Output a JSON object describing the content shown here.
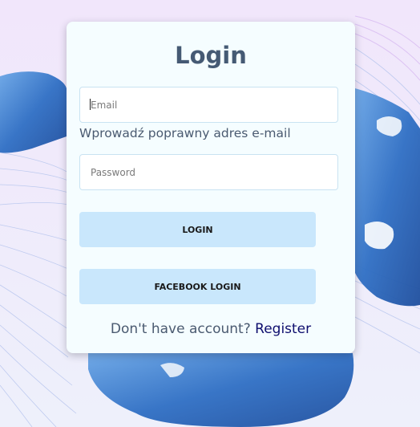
{
  "login_card": {
    "title": "Login",
    "email": {
      "placeholder": "Email",
      "value": ""
    },
    "email_hint": "Wprowadź poprawny adres e-mail",
    "password": {
      "placeholder": "Password",
      "value": ""
    },
    "login_button_label": "LOGIN",
    "facebook_button_label": "FACEBOOK LOGIN",
    "register_prompt": "Don't have account?",
    "register_link": "Register"
  },
  "colors": {
    "card_background": "#f5fdff",
    "title": "#455a74",
    "button_background": "#c9e7fc",
    "register_link": "#0e0e6e",
    "map_water": "#2f6fc4"
  }
}
